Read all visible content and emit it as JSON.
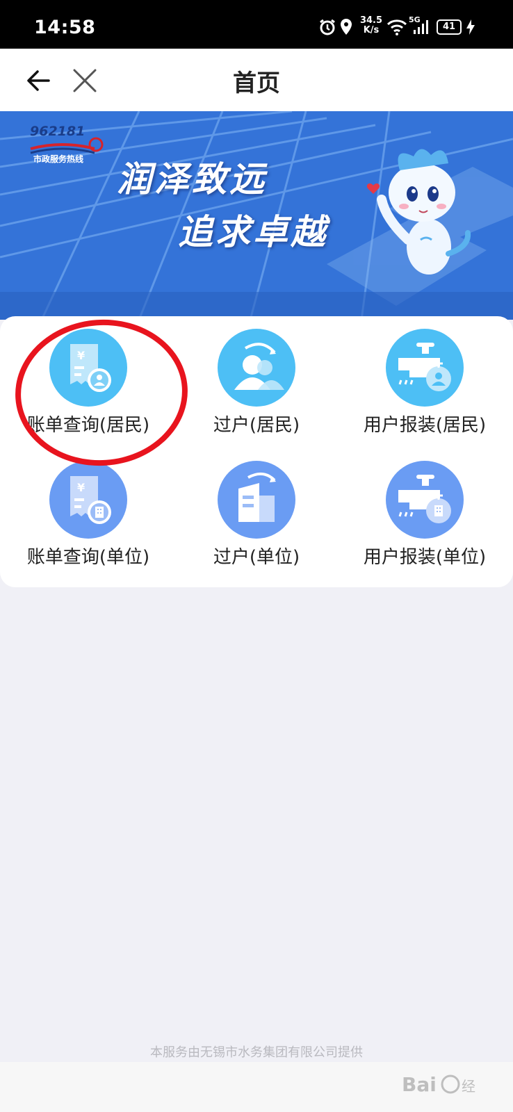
{
  "status_bar": {
    "time": "14:58",
    "net_speed_value": "34.5",
    "net_speed_unit": "K/s",
    "network": "5G",
    "battery": "41"
  },
  "nav": {
    "title": "首页"
  },
  "banner": {
    "hotline_number": "962181",
    "hotline_subtitle": "市政服务热线",
    "slogan_line1": "润泽致远",
    "slogan_line2": "追求卓越"
  },
  "services": [
    {
      "label": "账单查询(居民)",
      "icon": "bill-resident-icon"
    },
    {
      "label": "过户(居民)",
      "icon": "transfer-resident-icon"
    },
    {
      "label": "用户报装(居民)",
      "icon": "install-resident-icon"
    },
    {
      "label": "账单查询(单位)",
      "icon": "bill-company-icon"
    },
    {
      "label": "过户(单位)",
      "icon": "transfer-company-icon"
    },
    {
      "label": "用户报装(单位)",
      "icon": "install-company-icon"
    }
  ],
  "footer": {
    "note": "本服务由无锡市水务集团有限公司提供",
    "watermark": "Baidu 经验"
  },
  "colors": {
    "resident_icon": "#4dbff5",
    "company_icon": "#6a9cf3",
    "highlight": "#e8141e",
    "banner": "#2f6fd4"
  }
}
